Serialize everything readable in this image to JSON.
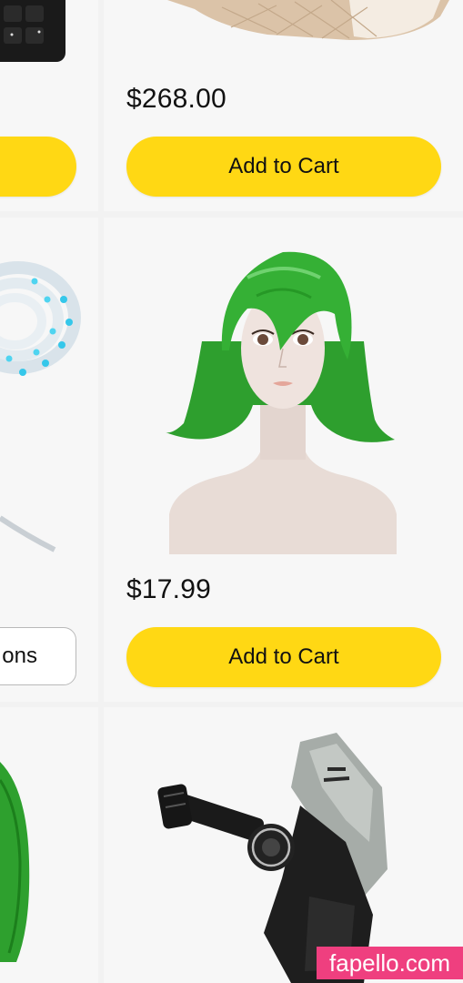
{
  "products": [
    {
      "price": "$268.00",
      "cart_label": "Add to Cart",
      "image": "quilted-cushion-product-image"
    },
    {
      "price": "$17.99",
      "cart_label": "Add to Cart",
      "image": "green-wig-on-mannequin-image"
    }
  ],
  "left_column": {
    "options_label": "ons",
    "images": [
      "keyboard-product-image",
      "led-strip-product-image",
      "green-wig-partial-image"
    ]
  },
  "bottom_right": {
    "image": "camera-mount-product-image"
  },
  "watermark": {
    "text": "fapello.com"
  },
  "colors": {
    "button_yellow": "#ffd814",
    "card_bg": "#f7f7f7",
    "page_bg": "#f2f2f2",
    "watermark_pink": "#ef3f7f"
  }
}
